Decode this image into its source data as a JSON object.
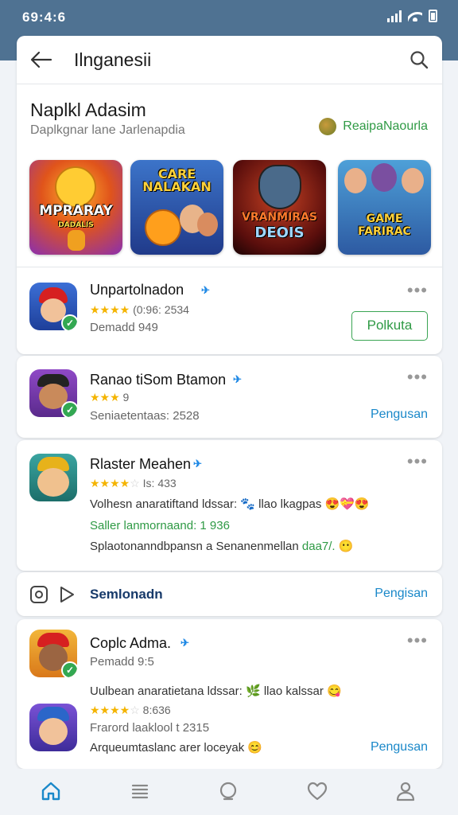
{
  "status": {
    "time": "69:4:6"
  },
  "header": {
    "title": "Ilnganesii"
  },
  "section": {
    "title": "Naplkl Adasim",
    "subtitle": "Daplkgnar lane Jarlenapdia",
    "region_label": "ReaipaNaourla"
  },
  "banners": [
    {
      "label": "MPRARAY",
      "sublabel": "DADALIS"
    },
    {
      "label": "CARE NALAKAN"
    },
    {
      "label": "VRANMIRAS",
      "sublabel": "DEOIS"
    },
    {
      "label": "GAME FARIRAC"
    }
  ],
  "apps": [
    {
      "name": "Unpartolnadon",
      "rating": 4,
      "meta": "(0:96: 2534",
      "sub": "Demadd 949",
      "action": "Polkuta"
    },
    {
      "name": "Ranao tiSom Btamon",
      "rating": 3,
      "meta": "9",
      "sub": "Seniaetentaas: 2528",
      "action": "Pengusan"
    },
    {
      "name": "Rlaster Meahen",
      "rating": 4,
      "meta": "Is: 433",
      "line1": "Volhesn anaratiftand ldssar: 🐾 llao lkagpas 😍💝😍",
      "line2": "Saller lanmornaand: 1 936",
      "line3_prefix": "Splaotonanndbpansn a Senanenmellan ",
      "line3_highlight": "daa7/.",
      "line3_suffix": " 😶"
    },
    {
      "name": "Coplc Adma.",
      "sub": "Pemadd 9:5",
      "line1": "Uulbean anaratietana ldssar: ",
      "line1_highlight": "🌿",
      "line1_suffix": " llao kalssar 😋",
      "rating": 4,
      "meta2": "8:636",
      "sub2": "Frarord laaklool t 2315",
      "line3": "Arqueumtaslanc arer loceyak 😊",
      "action": "Pengusan"
    }
  ],
  "promo_row": {
    "label": "Semlonadn",
    "action": "Pengisan"
  },
  "colors": {
    "statusbar": "#4f7292",
    "link": "#1a88c9",
    "install": "#2f9a45",
    "star": "#f4b400"
  },
  "nav": [
    {
      "icon": "home-icon",
      "active": true
    },
    {
      "icon": "list-icon"
    },
    {
      "icon": "chat-icon"
    },
    {
      "icon": "heart-icon"
    },
    {
      "icon": "profile-icon"
    }
  ]
}
